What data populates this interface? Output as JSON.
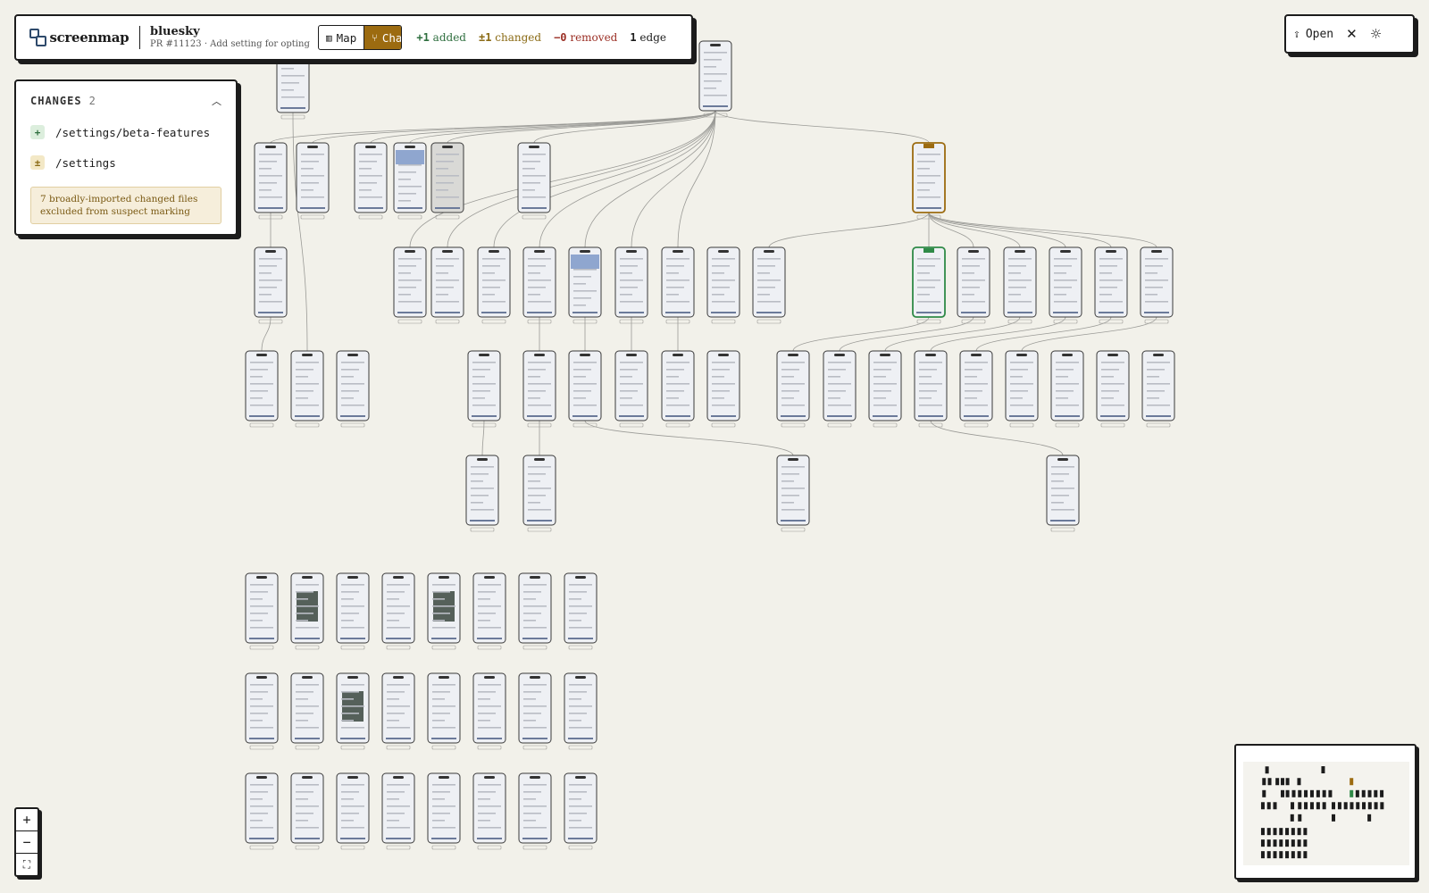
{
  "topbar": {
    "brand": "screenmap",
    "repo": "bluesky",
    "pr": "PR #11123 · Add setting for opting ...",
    "view_toggle": {
      "map_label": "Map",
      "changes_label": "Changes",
      "active": "Changes"
    },
    "stats": {
      "added_value": "+1",
      "added_label": "added",
      "changed_value": "±1",
      "changed_label": "changed",
      "removed_value": "−0",
      "removed_label": "removed",
      "edge_value": "1",
      "edge_label": "edge"
    }
  },
  "top_right": {
    "open_label": "Open"
  },
  "changes_panel": {
    "title": "CHANGES",
    "count": "2",
    "items": [
      {
        "badge": "+",
        "path": "/settings/beta-features",
        "kind": "added"
      },
      {
        "badge": "±",
        "path": "/settings",
        "kind": "changed"
      }
    ],
    "note": "7 broadly-imported changed files excluded from suspect marking"
  },
  "zoom": {
    "in": "+",
    "out": "−",
    "fit": "⛶"
  },
  "colors": {
    "background": "#f2f1ea",
    "border": "#1c1c1c",
    "changed": "#9c6b10",
    "added": "#2f8a47",
    "removed": "#9b2f25"
  },
  "icons": {
    "logo": "screenmap-logo-icon",
    "map": "map-icon",
    "changes": "git-diff-icon",
    "open": "upload-icon",
    "close": "close-icon",
    "theme": "sun-icon",
    "collapse": "chevron-up-icon"
  }
}
